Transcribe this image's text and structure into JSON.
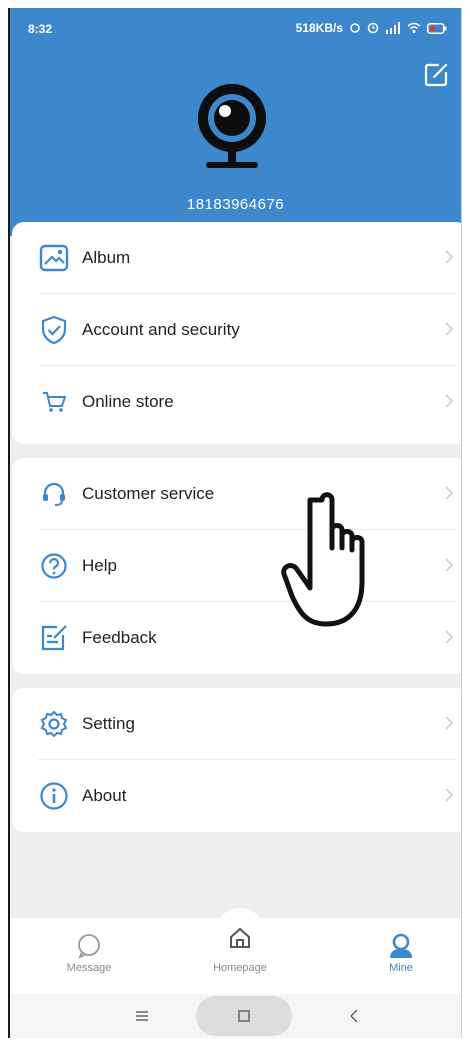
{
  "status_bar": {
    "time": "8:32",
    "right_text": "518KB/s"
  },
  "profile": {
    "phone": "18183964676"
  },
  "menu": {
    "group1": [
      {
        "label": "Album",
        "icon": "album-icon"
      },
      {
        "label": "Account and security",
        "icon": "shield-icon"
      },
      {
        "label": "Online store",
        "icon": "cart-icon"
      }
    ],
    "group2": [
      {
        "label": "Customer service",
        "icon": "headset-icon"
      },
      {
        "label": "Help",
        "icon": "help-icon"
      },
      {
        "label": "Feedback",
        "icon": "feedback-icon"
      }
    ],
    "group3": [
      {
        "label": "Setting",
        "icon": "gear-icon"
      },
      {
        "label": "About",
        "icon": "info-icon"
      }
    ]
  },
  "bottom_nav": {
    "message": "Message",
    "homepage": "Homepage",
    "mine": "Mine"
  },
  "colors": {
    "accent": "#3d88cc",
    "background": "#eeeeee"
  }
}
